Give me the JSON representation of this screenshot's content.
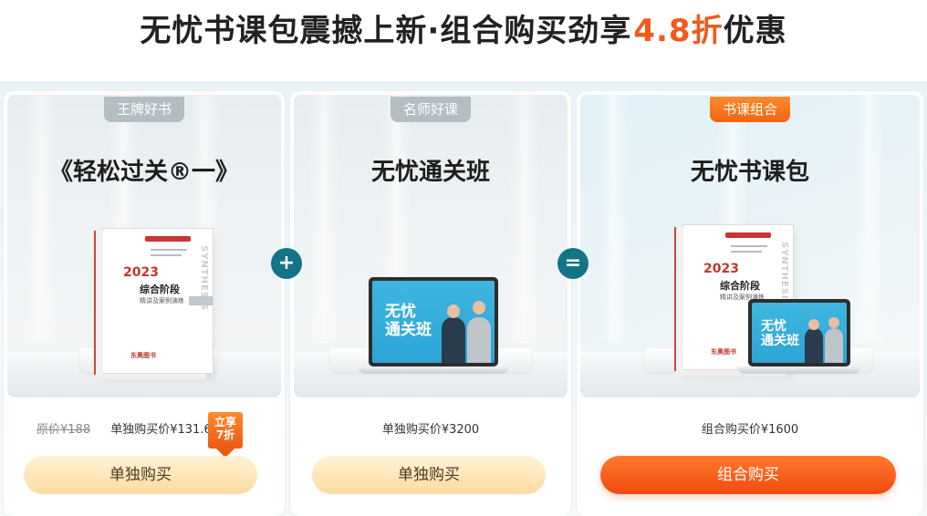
{
  "headline": {
    "main": "无忧书课包震撼上新·组合购买劲享",
    "accent": "4.8折",
    "tail": "优惠"
  },
  "cards": [
    {
      "tag": "王牌好书",
      "title": "《轻松过关®一》",
      "original_price": "原价¥188",
      "price_label": "单独购买价¥131.6",
      "badge": "立享7折",
      "button": "单独购买"
    },
    {
      "tag": "名师好课",
      "title": "无忧通关班",
      "price_label": "单独购买价¥3200",
      "button": "单独购买"
    },
    {
      "tag": "书课组合",
      "title": "无忧书课包",
      "price_label": "组合购买价¥1600",
      "button": "组合购买"
    }
  ],
  "operators": {
    "plus": "+",
    "equals": "="
  },
  "book": {
    "year": "2023",
    "title": "综合阶段",
    "subtitle": "精讲及案例演练",
    "vertical_text": "SYNTHESIS",
    "publisher": "东奥图书"
  },
  "screen_title": "无忧\n通关班",
  "colors": {
    "accent": "#f05a1a",
    "operator": "#127486",
    "tag_grey": "#b4bec2",
    "tag_orange": "#f26411"
  },
  "icons": [
    "book-product-image",
    "laptop-product-image",
    "plus-icon",
    "equals-icon"
  ]
}
